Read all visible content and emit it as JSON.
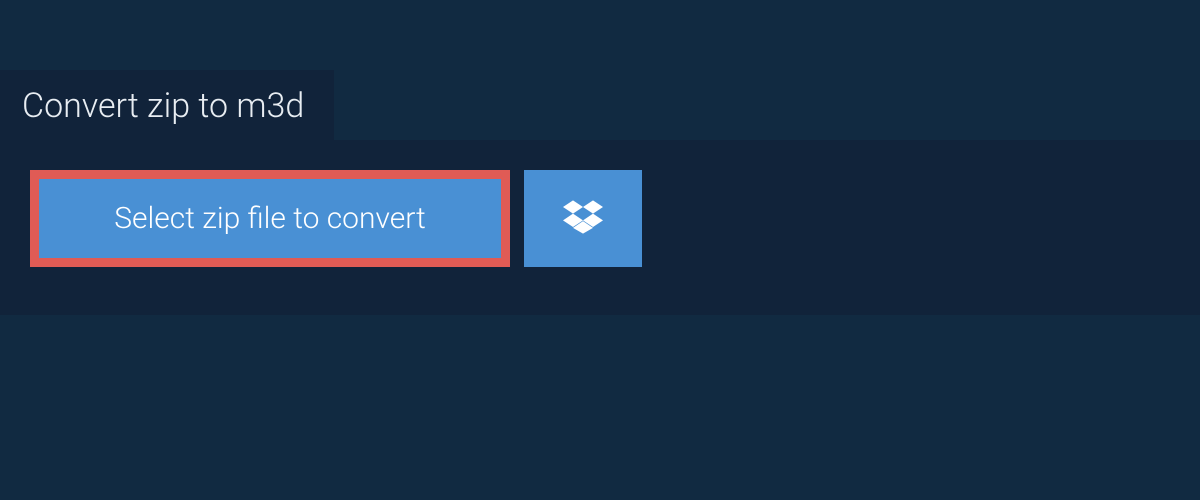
{
  "tab": {
    "label": "Convert zip to m3d"
  },
  "buttons": {
    "select_file_label": "Select zip file to convert"
  },
  "icons": {
    "dropbox": "dropbox-icon"
  },
  "colors": {
    "page_bg": "#112a41",
    "panel_bg": "#11233a",
    "button_bg": "#4990d4",
    "highlight_border": "#e05b55",
    "text": "#ffffff"
  }
}
